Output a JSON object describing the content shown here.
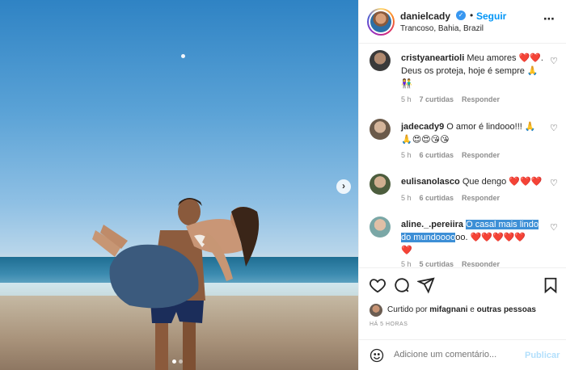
{
  "post": {
    "username": "danielcady",
    "follow_label": "Seguir",
    "separator": "•",
    "location": "Trancoso, Bahia, Brazil",
    "more_icon": "more-horizontal-icon",
    "verified_icon": "verified-badge-icon"
  },
  "comments": [
    {
      "username": "cristyaneartioli",
      "text_before": " Meu amores ",
      "emoji1": "❤️❤️",
      "text_after": ". Deus os proteja, hoje é sempre 🙏",
      "extra": "👫",
      "time": "5 h",
      "likes": "7 curtidas",
      "reply": "Responder"
    },
    {
      "username": "jadecady9",
      "text_before": " O amor é lindooo!!! 🙏",
      "emoji1": "🙏😍😍😘😘",
      "time": "5 h",
      "likes": "6 curtidas",
      "reply": "Responder"
    },
    {
      "username": "eulisanolasco",
      "text_before": " Que dengo ",
      "emoji1": "❤️❤️❤️",
      "time": "5 h",
      "likes": "6 curtidas",
      "reply": "Responder"
    },
    {
      "username": "aline._.pereiira",
      "highlighted": "O casal mais lindo do mundoooo",
      "text_after": "oo. ",
      "emoji1": "❤️❤️❤️❤️❤️",
      "emoji2": "❤️",
      "time": "5 h",
      "likes": "5 curtidas",
      "reply": "Responder"
    }
  ],
  "likes_line": {
    "prefix": "Curtido por ",
    "user": "mifagnani",
    "middle": " e ",
    "others": "outras pessoas"
  },
  "time_ago": "HÁ 5 HORAS",
  "add_comment": {
    "placeholder": "Adicione um comentário...",
    "post_label": "Publicar"
  },
  "carousel": {
    "next_icon": "chevron-right-icon",
    "dots_count": 2,
    "active_dot": 0
  },
  "colors": {
    "accent": "#0095f6",
    "verified": "#3897f0",
    "highlight": "#3d8fd6",
    "muted": "#8e8e8e"
  }
}
